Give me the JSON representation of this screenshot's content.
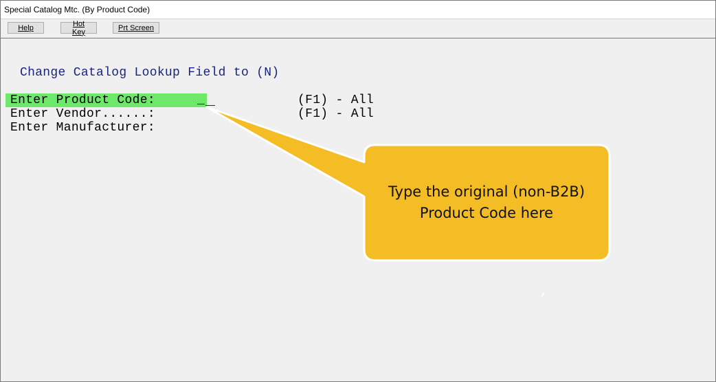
{
  "window": {
    "title": "Special Catalog Mtc. (By Product Code)"
  },
  "toolbar": {
    "help_label": "Help",
    "hotkey_label": "Hot Key",
    "prtscreen_label": "Prt Screen"
  },
  "terminal": {
    "heading": "Change Catalog Lookup Field to (N)",
    "product_code_label": "Enter Product Code:",
    "product_code_value": "_",
    "product_code_hint": "(F1) - All",
    "vendor_label": "Enter Vendor......:",
    "vendor_hint": "(F1) - All",
    "manufacturer_label": "Enter Manufacturer:"
  },
  "callout": {
    "line1": "Type the original (non-B2B)",
    "line2": "Product Code here"
  },
  "colors": {
    "highlight": "#6de86b",
    "heading": "#1a237e",
    "callout_fill": "#f4bc25",
    "callout_border": "#ffffff"
  }
}
